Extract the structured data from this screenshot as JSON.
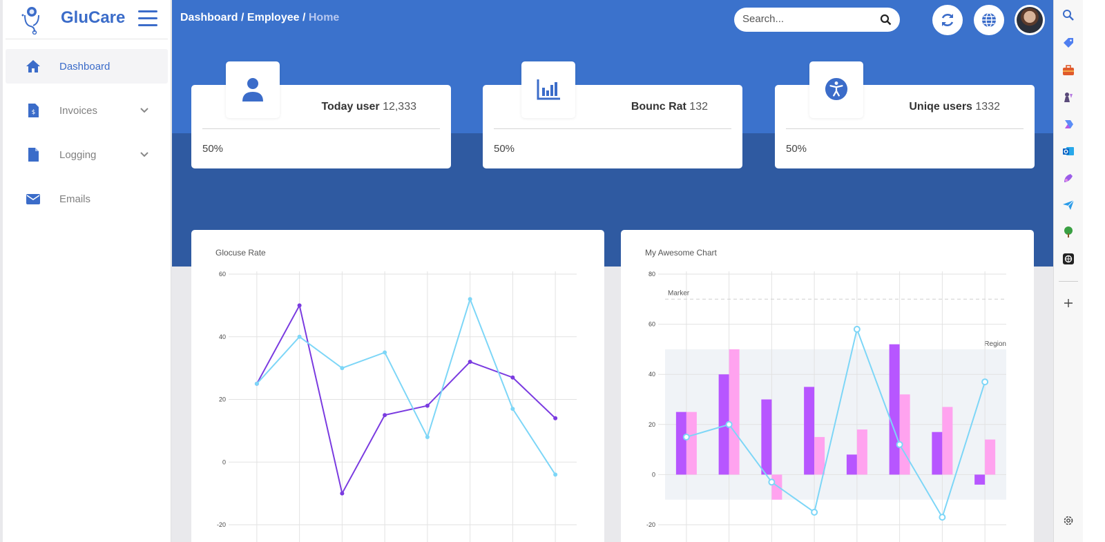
{
  "app": {
    "name": "GluCare"
  },
  "breadcrumb": {
    "part1": "Dashboard",
    "sep": " / ",
    "part2": "Employee",
    "current": "Home"
  },
  "search": {
    "placeholder": "Search..."
  },
  "sidebar": {
    "items": [
      {
        "label": "Dashboard",
        "icon": "home-icon",
        "active": true
      },
      {
        "label": "Invoices",
        "icon": "invoice-icon",
        "expandable": true
      },
      {
        "label": "Logging",
        "icon": "file-icon",
        "expandable": true
      },
      {
        "label": "Emails",
        "icon": "envelope-icon"
      }
    ]
  },
  "stats": [
    {
      "label": "Today user",
      "value": "12,333",
      "percent": "50%",
      "icon": "user-icon"
    },
    {
      "label": "Bounc Rat",
      "value": "132",
      "percent": "50%",
      "icon": "bar-chart-icon"
    },
    {
      "label": "Uniqe users",
      "value": "1332",
      "percent": "50%",
      "icon": "accessibility-icon"
    }
  ],
  "colors": {
    "primary": "#3b72cc",
    "primary_dark": "#2f5aa1",
    "purple": "#7a3be0",
    "cyan": "#7dd6f7",
    "bar_purple": "#b756ff",
    "bar_pink": "#ffa3ef"
  },
  "chart_data": [
    {
      "type": "line",
      "title": "Glocuse Rate",
      "ylim": [
        -20,
        60
      ],
      "yticks": [
        60,
        40,
        20,
        0,
        -20
      ],
      "grid": true,
      "series": [
        {
          "values": [
            25,
            50,
            -10,
            15,
            18,
            32,
            27,
            14
          ],
          "color": "#7a3be0"
        },
        {
          "values": [
            25,
            40,
            30,
            35,
            8,
            52,
            17,
            -4
          ],
          "color": "#7dd6f7"
        }
      ]
    },
    {
      "type": "bar",
      "title": "My Awesome Chart",
      "ylim": [
        -20,
        80
      ],
      "yticks": [
        80,
        60,
        40,
        20,
        0,
        -20
      ],
      "grid": true,
      "marker": {
        "label": "Marker",
        "value": 70
      },
      "region": {
        "label": "Region",
        "from": -10,
        "to": 50
      },
      "series": [
        {
          "values": [
            25,
            40,
            30,
            35,
            8,
            52,
            17,
            -4
          ],
          "color": "#b756ff",
          "kind": "bar"
        },
        {
          "values": [
            25,
            50,
            -10,
            15,
            18,
            32,
            27,
            14
          ],
          "color": "#ffa3ef",
          "kind": "bar"
        },
        {
          "values": [
            15,
            20,
            -3,
            -15,
            58,
            12,
            -17,
            37
          ],
          "color": "#7dd6f7",
          "kind": "line"
        }
      ]
    }
  ],
  "rail": {
    "icons": [
      "search-icon",
      "tag-icon",
      "briefcase-icon",
      "chess-icon",
      "copilot-icon",
      "outlook-icon",
      "designer-icon",
      "send-icon",
      "tree-icon",
      "openai-icon",
      "plus-icon",
      "settings-icon"
    ]
  }
}
